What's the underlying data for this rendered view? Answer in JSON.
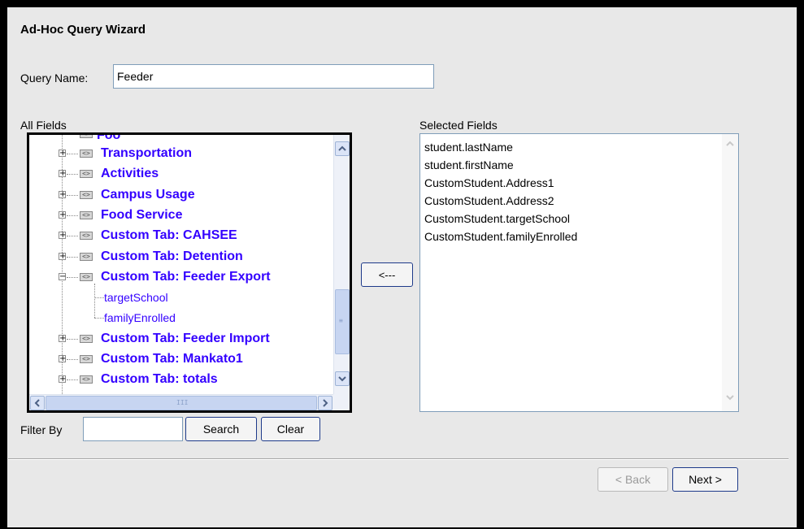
{
  "wizard": {
    "title": "Ad-Hoc Query Wizard"
  },
  "query": {
    "label": "Query Name:",
    "value": "Feeder"
  },
  "all_fields": {
    "label": "All Fields",
    "partial_top_label": "Foo",
    "nodes": [
      {
        "label": "Transportation",
        "expanded": false
      },
      {
        "label": "Activities",
        "expanded": false
      },
      {
        "label": "Campus Usage",
        "expanded": false
      },
      {
        "label": "Food Service",
        "expanded": false
      },
      {
        "label": "Custom Tab: CAHSEE",
        "expanded": false
      },
      {
        "label": "Custom Tab: Detention",
        "expanded": false
      },
      {
        "label": "Custom Tab: Feeder Export",
        "expanded": true
      },
      {
        "label": "targetSchool",
        "leaf": true
      },
      {
        "label": "familyEnrolled",
        "leaf": true
      },
      {
        "label": "Custom Tab: Feeder Import",
        "expanded": false
      },
      {
        "label": "Custom Tab: Mankato1",
        "expanded": false
      },
      {
        "label": "Custom Tab: totals",
        "expanded": false
      }
    ]
  },
  "move_button": {
    "label": "<---"
  },
  "selected_fields": {
    "label": "Selected Fields",
    "items": [
      "student.lastName",
      "student.firstName",
      "CustomStudent.Address1",
      "CustomStudent.Address2",
      "CustomStudent.targetSchool",
      "CustomStudent.familyEnrolled"
    ]
  },
  "filter": {
    "label": "Filter By",
    "value": "",
    "search_label": "Search",
    "clear_label": "Clear"
  },
  "footer": {
    "back_label": "< Back",
    "next_label": "Next >"
  }
}
